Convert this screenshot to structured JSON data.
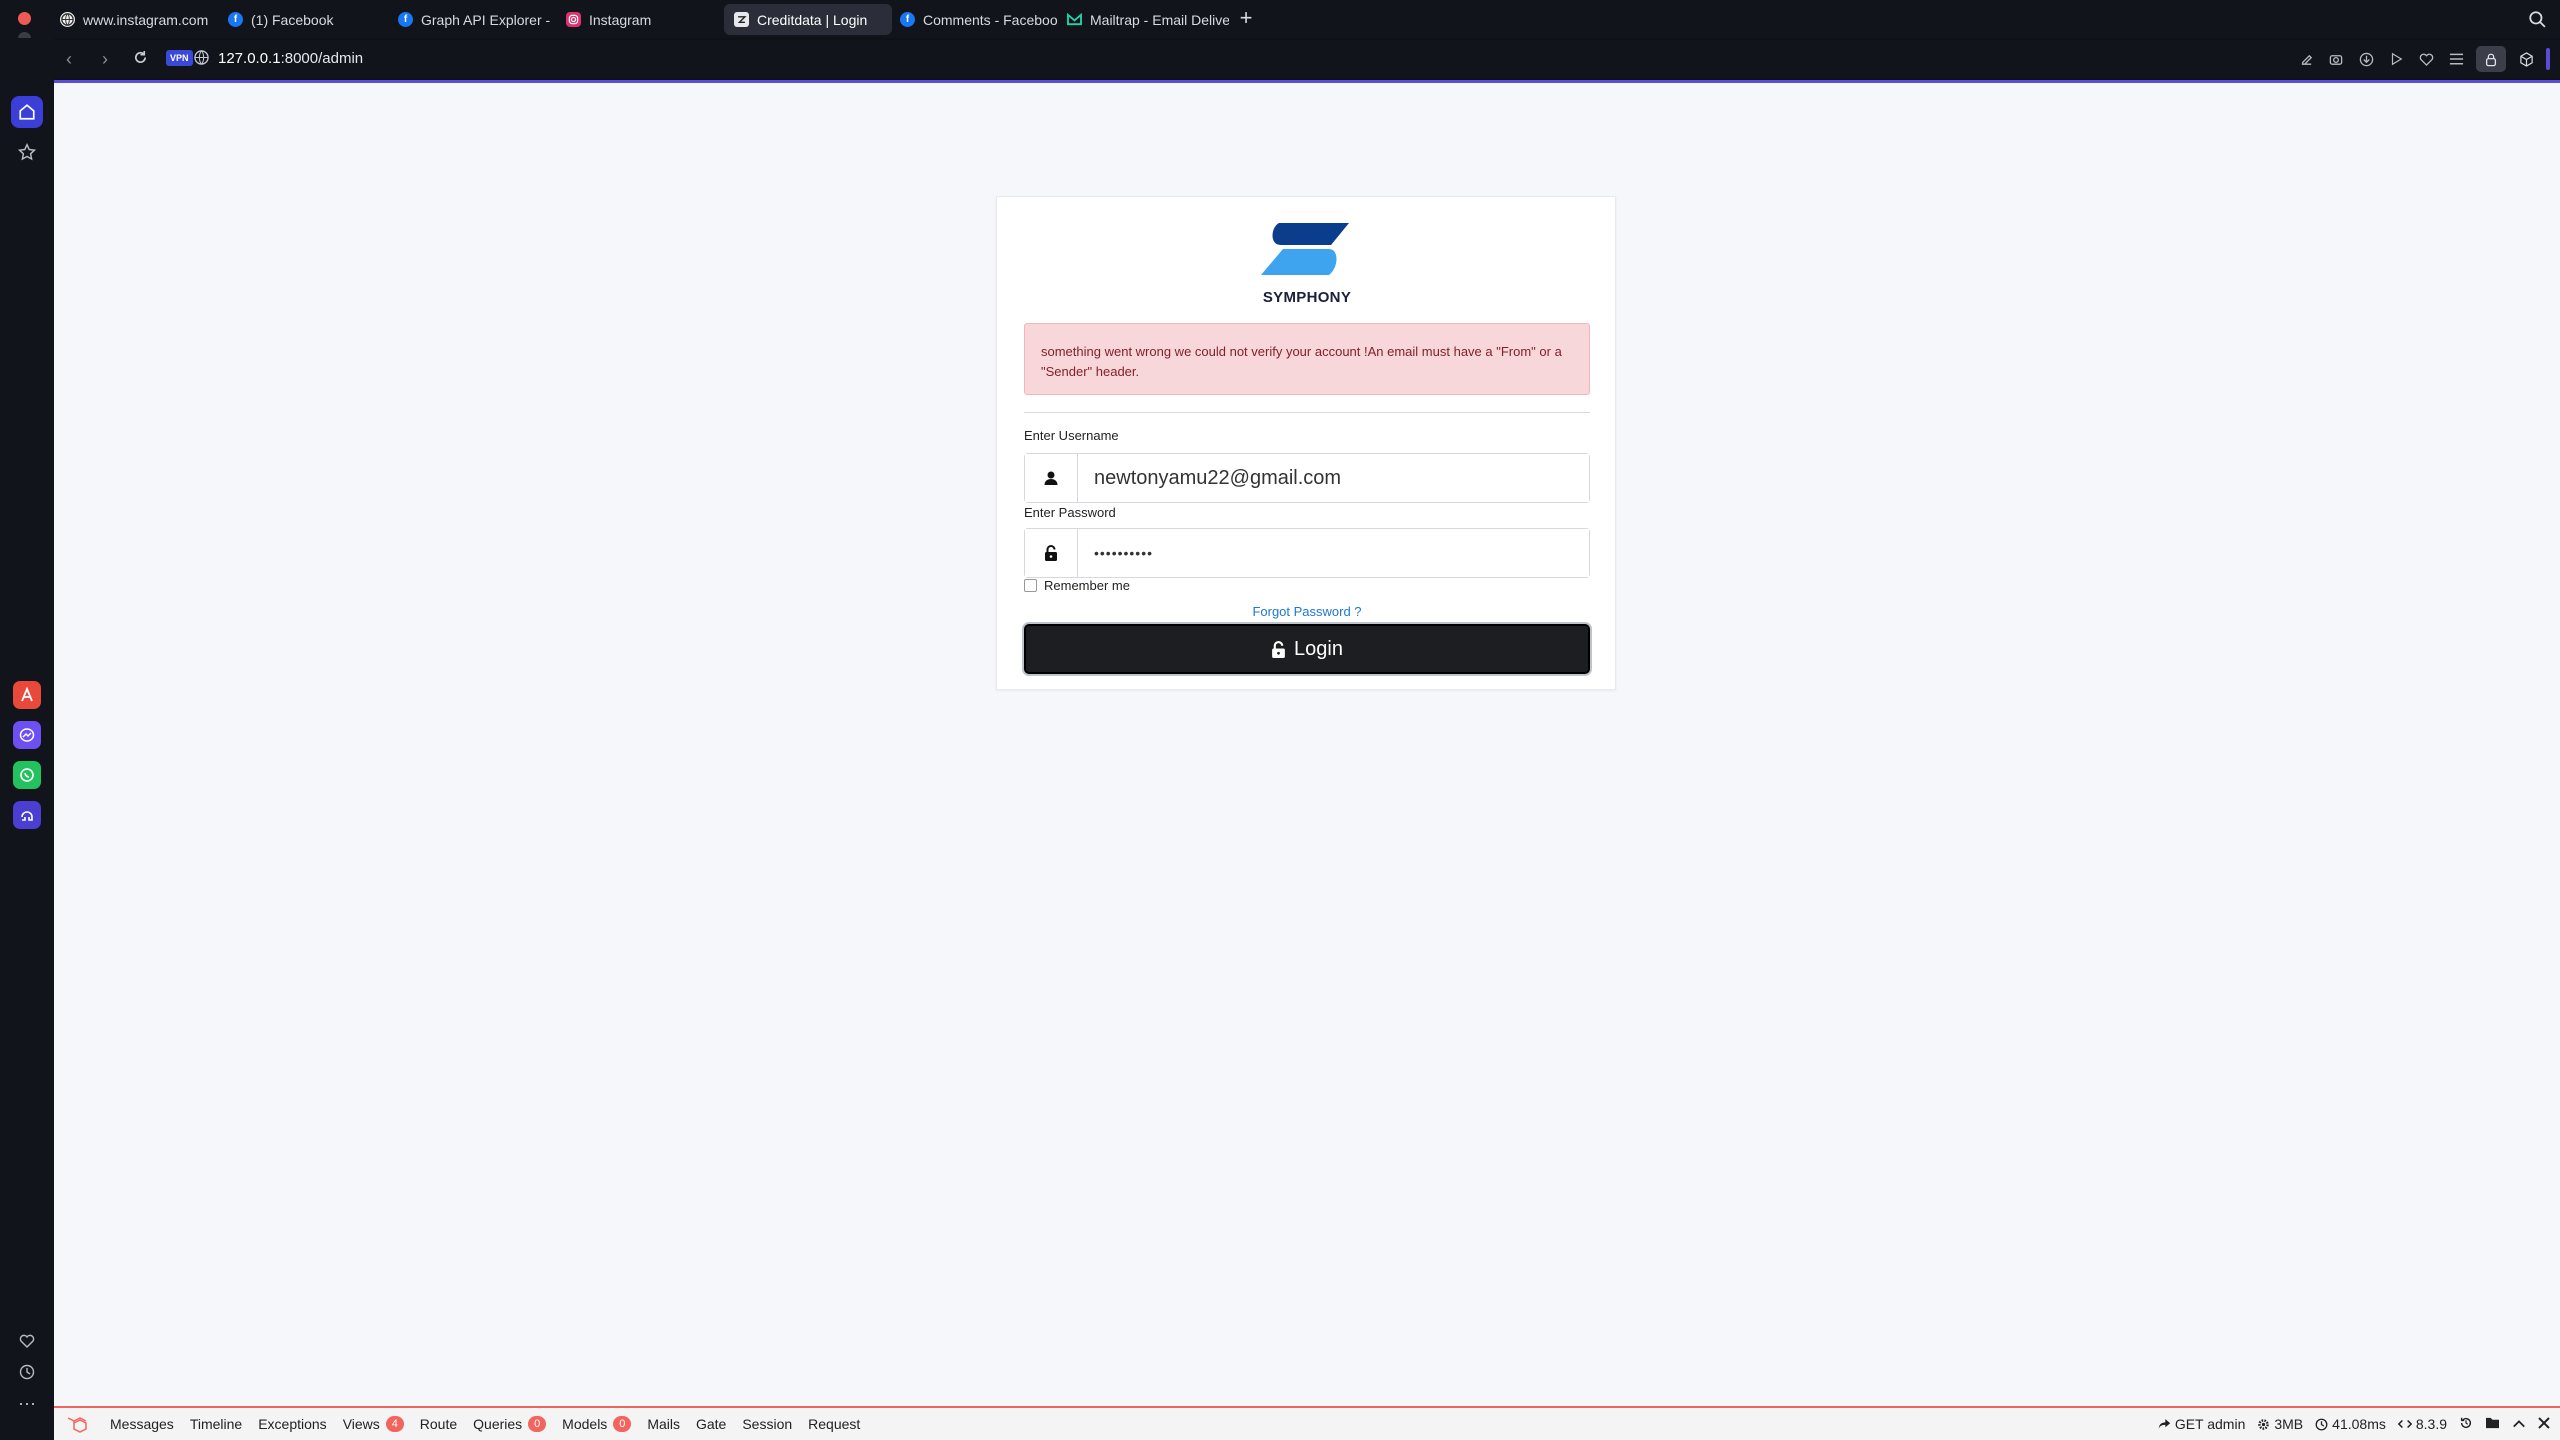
{
  "browser": {
    "tabs": [
      {
        "label": "www.instagram.com",
        "icon": "globe-icon",
        "active": false
      },
      {
        "label": "(1) Facebook",
        "icon": "facebook-icon",
        "active": false
      },
      {
        "label": "Graph API Explorer - Me",
        "icon": "facebook-icon",
        "active": false
      },
      {
        "label": "Instagram",
        "icon": "instagram-icon",
        "active": false
      },
      {
        "label": "Creditdata | Login",
        "icon": "page-icon",
        "active": true
      },
      {
        "label": "Comments - Facebook I",
        "icon": "facebook-icon",
        "active": false
      },
      {
        "label": "Mailtrap - Email Delivery",
        "icon": "mailtrap-icon",
        "active": false
      }
    ],
    "new_tab_label": "+",
    "address": {
      "vpn_label": "VPN",
      "host": "127.0.0.1",
      "path": ":8000/admin"
    }
  },
  "login": {
    "brand": "SYMPHONY",
    "alert": "something went wrong we could not verify your account !An email must have a \"From\" or a \"Sender\" header.",
    "username_label": "Enter Username",
    "username_value": "newtonyamu22@gmail.com",
    "password_label": "Enter Password",
    "password_value": "••••••••••",
    "remember_label": "Remember me",
    "forgot_label": "Forgot Password ?",
    "login_label": "Login"
  },
  "debugbar": {
    "items": [
      {
        "label": "Messages"
      },
      {
        "label": "Timeline"
      },
      {
        "label": "Exceptions"
      },
      {
        "label": "Views",
        "badge": "4"
      },
      {
        "label": "Route"
      },
      {
        "label": "Queries",
        "badge": "0"
      },
      {
        "label": "Models",
        "badge": "0"
      },
      {
        "label": "Mails"
      },
      {
        "label": "Gate"
      },
      {
        "label": "Session"
      },
      {
        "label": "Request"
      }
    ],
    "request": "GET admin",
    "memory": "3MB",
    "time": "41.08ms",
    "version": "8.3.9"
  },
  "colors": {
    "accent": "#3b3fd8",
    "alert_bg": "#f8d7da",
    "alert_text": "#842029",
    "link": "#1e77d2",
    "debugbar_accent": "#f4645f"
  }
}
